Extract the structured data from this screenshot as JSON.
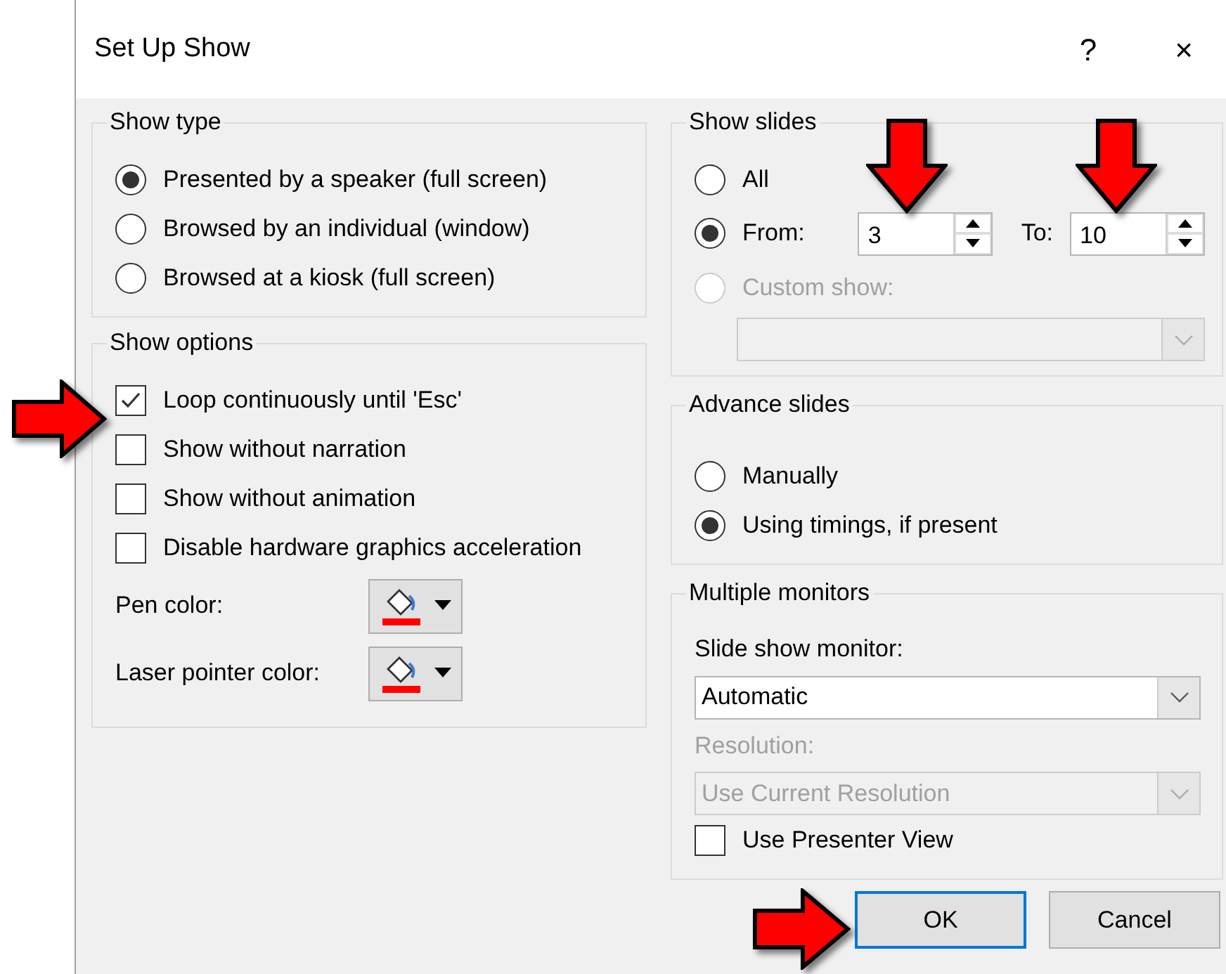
{
  "window": {
    "title": "Set Up Show",
    "help": "?",
    "close": "×"
  },
  "show_type": {
    "title": "Show type",
    "options": [
      {
        "label": "Presented by a speaker (full screen)",
        "selected": true
      },
      {
        "label": "Browsed by an individual (window)",
        "selected": false
      },
      {
        "label": "Browsed at a kiosk (full screen)",
        "selected": false
      }
    ]
  },
  "show_options": {
    "title": "Show options",
    "checkboxes": [
      {
        "label": "Loop continuously until 'Esc'",
        "checked": true
      },
      {
        "label": "Show without narration",
        "checked": false
      },
      {
        "label": "Show without animation",
        "checked": false
      },
      {
        "label": "Disable hardware graphics acceleration",
        "checked": false
      }
    ],
    "colors": [
      {
        "label": "Pen color:",
        "color": "#ff0000"
      },
      {
        "label": "Laser pointer color:",
        "color": "#ff0000"
      }
    ]
  },
  "show_slides": {
    "title": "Show slides",
    "options": [
      {
        "kind": "plain",
        "label": "All",
        "selected": false,
        "disabled": false
      },
      {
        "kind": "range",
        "label": "From:",
        "selected": true,
        "disabled": false,
        "from": "3",
        "to_label": "To:",
        "to": "10"
      },
      {
        "kind": "custom",
        "label": "Custom show:",
        "selected": false,
        "disabled": true
      }
    ]
  },
  "advance_slides": {
    "title": "Advance slides",
    "options": [
      {
        "label": "Manually",
        "selected": false
      },
      {
        "label": "Using timings, if present",
        "selected": true
      }
    ]
  },
  "multiple_monitors": {
    "title": "Multiple monitors",
    "monitor_label": "Slide show monitor:",
    "monitor_value": "Automatic",
    "resolution_label": "Resolution:",
    "resolution_value": "Use Current Resolution",
    "resolution_disabled": true,
    "presenter_view": {
      "label": "Use Presenter View",
      "checked": false
    }
  },
  "buttons": [
    {
      "label": "OK",
      "kind": "default"
    },
    {
      "label": "Cancel",
      "kind": "normal"
    }
  ]
}
